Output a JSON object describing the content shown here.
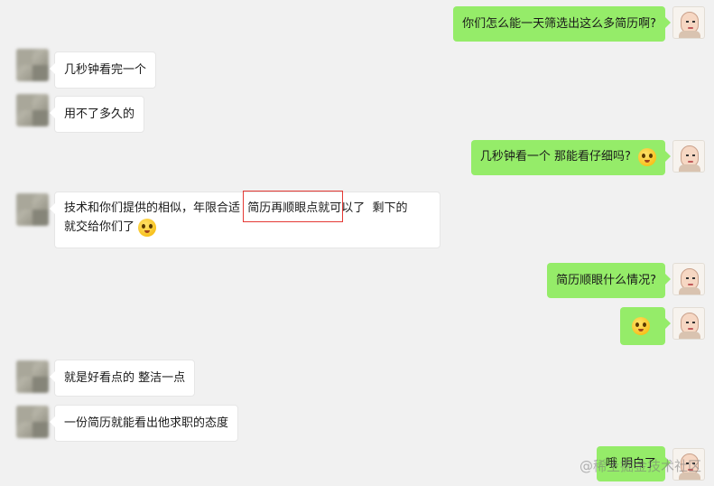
{
  "messages": [
    {
      "side": "right",
      "text": "你们怎么能一天筛选出这么多简历啊?"
    },
    {
      "side": "left",
      "text": "几秒钟看完一个"
    },
    {
      "side": "left",
      "text": "用不了多久的"
    },
    {
      "side": "right",
      "text": "几秒钟看一个 那能看仔细吗?",
      "emoji": "shocked-emoji"
    },
    {
      "side": "left",
      "line1": "技术和你们提供的相似，年限合适  简历再顺眼点就可以了  剩下的",
      "line2": "就交给你们了",
      "emoji": "thinking-emoji"
    },
    {
      "side": "right",
      "text": "简历顺眼什么情况?"
    },
    {
      "side": "right",
      "emoji": "angry-emoji"
    },
    {
      "side": "left",
      "text": "就是好看点的 整洁一点"
    },
    {
      "side": "left",
      "text": "一份简历就能看出他求职的态度"
    },
    {
      "side": "right",
      "text": "哦 明白了"
    }
  ],
  "watermark": "@稀土掘金技术社区",
  "colors": {
    "background": "#f1f1f1",
    "self_bubble": "#95ec69",
    "other_bubble": "#ffffff",
    "highlight": "#e53935"
  }
}
